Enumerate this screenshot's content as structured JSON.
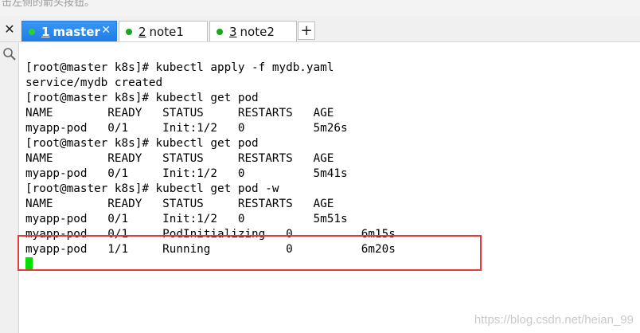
{
  "top_hint": "击左侧的箭头按钮。",
  "tabs": [
    {
      "number": "1",
      "label": "master",
      "active": true,
      "close": "✕"
    },
    {
      "number": "2",
      "label": "note1",
      "active": false
    },
    {
      "number": "3",
      "label": "note2",
      "active": false
    }
  ],
  "tabbar_close": "✕",
  "add_tab": "+",
  "terminal": {
    "lines": [
      "[root@master k8s]# kubectl apply -f mydb.yaml",
      "service/mydb created",
      "[root@master k8s]# kubectl get pod",
      "NAME        READY   STATUS     RESTARTS   AGE",
      "myapp-pod   0/1     Init:1/2   0          5m26s",
      "[root@master k8s]# kubectl get pod",
      "NAME        READY   STATUS     RESTARTS   AGE",
      "myapp-pod   0/1     Init:1/2   0          5m41s",
      "[root@master k8s]# kubectl get pod -w",
      "NAME        READY   STATUS     RESTARTS   AGE",
      "myapp-pod   0/1     Init:1/2   0          5m51s",
      "myapp-pod   0/1     PodInitializing   0          6m15s",
      "myapp-pod   1/1     Running           0          6m20s"
    ]
  },
  "watermark": "https://blog.csdn.net/heian_99",
  "colors": {
    "active_tab": "#1e7de6",
    "tab_dot": "#18a81e",
    "cursor": "#00e000",
    "highlight_box": "#e83a3a"
  }
}
